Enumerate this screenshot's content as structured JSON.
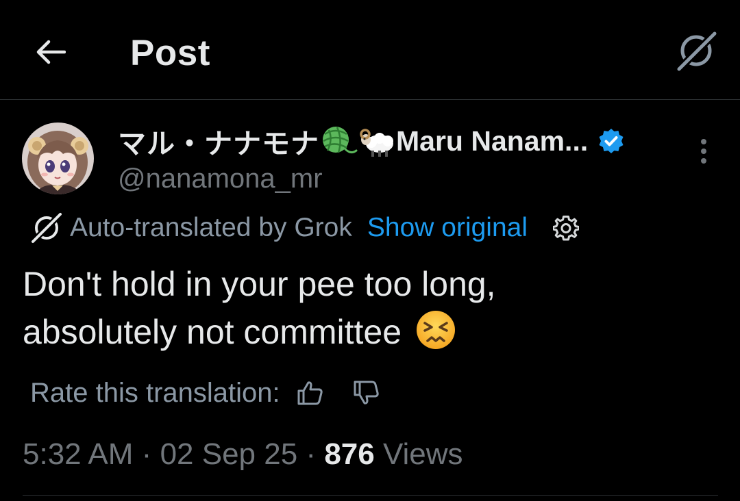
{
  "header": {
    "title": "Post",
    "back_icon": "arrow-left-icon",
    "grok_icon": "grok-icon"
  },
  "author": {
    "display_name_jp": "マル・ナナモナ",
    "display_name_en": "Maru Nanam...",
    "name_emojis": [
      "yarn-emoji",
      "ram-emoji"
    ],
    "handle": "@nanamona_mr",
    "verified": true,
    "verified_color": "#1d9bf0"
  },
  "translation": {
    "label": "Auto-translated by Grok",
    "show_original": "Show original"
  },
  "post": {
    "line1": "Don't hold in your pee too long,",
    "line2": "absolutely not committee",
    "emoji": "persevering-face-emoji"
  },
  "rating": {
    "label": "Rate this translation:"
  },
  "meta": {
    "time": "5:32 AM",
    "date": "02 Sep 25",
    "views_count": "876",
    "views_label": "Views",
    "separator": "·"
  },
  "colors": {
    "background": "#000000",
    "text": "#e7e9ea",
    "muted": "#71767b",
    "link": "#1d9bf0",
    "divider": "#2f3336"
  }
}
